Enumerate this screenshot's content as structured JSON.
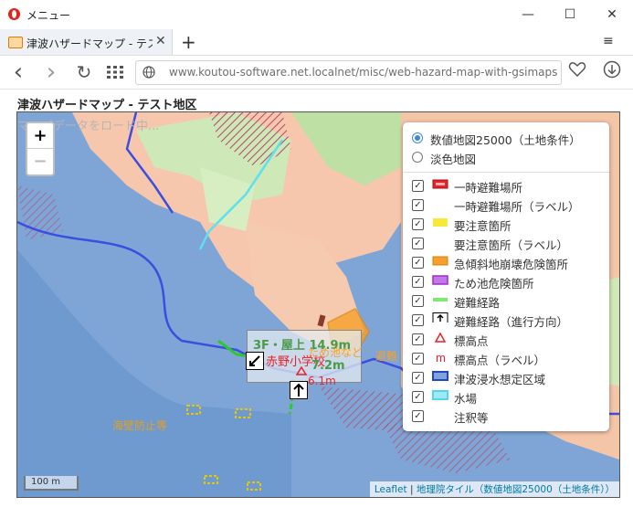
{
  "window": {
    "title": "メニュー",
    "minimize": "—",
    "maximize": "☐",
    "close": "✕"
  },
  "tab": {
    "title": "津波ハザードマップ - テスト地区",
    "close": "✕",
    "new_tab": "+",
    "menu": "≡"
  },
  "nav": {
    "back": "‹",
    "forward": "›",
    "reload": "↻",
    "url": "www.koutou-software.net.localnet/misc/web-hazard-map-with-gsimaps-a"
  },
  "page": {
    "title": "津波ハザードマップ - テスト地区"
  },
  "map": {
    "loading_text": "マップデータをロード中...",
    "zoom_in": "+",
    "zoom_out": "−",
    "scale": "100 m",
    "attribution": {
      "leaflet": "Leaflet",
      "sep": " | ",
      "source": "地理院タイル（数値地図25000（土地条件））"
    },
    "labels": {
      "floor": "3F・屋上 14.9m",
      "school": "赤野小学校",
      "elev1": "7.2m",
      "elev2": "6.1m",
      "seawall": "海壁防止等",
      "orange1": "ため池など",
      "orange2": "避難"
    }
  },
  "layers": {
    "base": [
      {
        "label": "数値地図25000（土地条件）",
        "selected": true
      },
      {
        "label": "淡色地図",
        "selected": false
      }
    ],
    "overlays": [
      {
        "label": "一時避難場所",
        "icon": "red-rect-icon",
        "color": "#e8222a"
      },
      {
        "label": "一時避難場所（ラベル）",
        "icon": "none"
      },
      {
        "label": "要注意箇所",
        "icon": "yellow-rect-icon",
        "color": "#f7e93a"
      },
      {
        "label": "要注意箇所（ラベル）",
        "icon": "none"
      },
      {
        "label": "急傾斜地崩壊危険箇所",
        "icon": "orange-rect-icon",
        "color": "#f7a02b"
      },
      {
        "label": "ため池危険箇所",
        "icon": "purple-rect-icon",
        "color": "#9d2bd1"
      },
      {
        "label": "避難経路",
        "icon": "green-line-icon",
        "color": "#7ee874"
      },
      {
        "label": "避難経路（進行方向）",
        "icon": "arrow-box-icon"
      },
      {
        "label": "標高点",
        "icon": "triangle-icon",
        "color": "#e8222a"
      },
      {
        "label": "標高点（ラベル）",
        "icon": "m-icon",
        "color": "#e8222a"
      },
      {
        "label": "津波浸水想定区域",
        "icon": "blue-rect-icon",
        "color": "#2346c8"
      },
      {
        "label": "水場",
        "icon": "cyan-rect-icon",
        "color": "#55d5e8"
      },
      {
        "label": "注釈等",
        "icon": "none"
      }
    ]
  }
}
